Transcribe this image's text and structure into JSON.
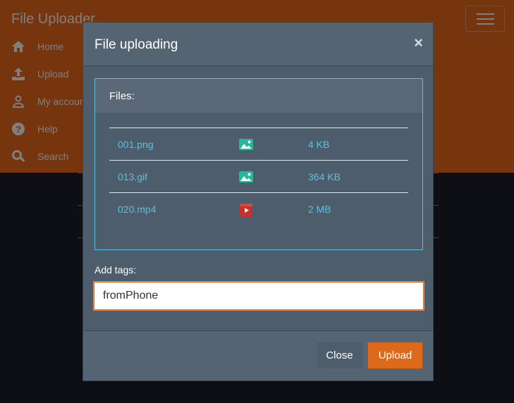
{
  "app": {
    "brand": "File Uploader"
  },
  "nav": {
    "items": [
      {
        "label": "Home",
        "icon": "home-icon"
      },
      {
        "label": "Upload",
        "icon": "upload-icon"
      },
      {
        "label": "My account",
        "icon": "user-icon"
      },
      {
        "label": "Help",
        "icon": "question-icon"
      },
      {
        "label": "Search",
        "icon": "search-icon"
      }
    ]
  },
  "modal": {
    "title": "File uploading",
    "close_glyph": "×",
    "files_header": "Files:",
    "files": [
      {
        "name": "001.png",
        "type_icon": "image-icon",
        "size": "4 KB"
      },
      {
        "name": "013.gif",
        "type_icon": "image-icon",
        "size": "364 KB"
      },
      {
        "name": "020.mp4",
        "type_icon": "video-icon",
        "size": "2 MB"
      }
    ],
    "tags_label": "Add tags:",
    "tags_value": "fromPhone",
    "close_button": "Close",
    "upload_button": "Upload"
  },
  "colors": {
    "navbar": "#ee6a1d",
    "modal_bg": "#4e5d6c",
    "accent_link": "#5bc0de",
    "primary_button": "#df691a",
    "page_bg": "#1a1f28"
  }
}
